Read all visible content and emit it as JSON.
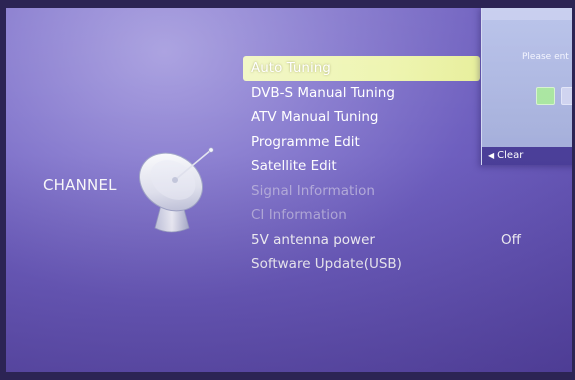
{
  "section": {
    "title": "CHANNEL"
  },
  "menu": {
    "items": [
      {
        "label": "Auto Tuning",
        "state": "selected"
      },
      {
        "label": "DVB-S Manual Tuning",
        "state": "enabled"
      },
      {
        "label": "ATV Manual Tuning",
        "state": "enabled"
      },
      {
        "label": "Programme Edit",
        "state": "enabled"
      },
      {
        "label": "Satellite Edit",
        "state": "enabled"
      },
      {
        "label": "Signal Information",
        "state": "disabled"
      },
      {
        "label": "CI Information",
        "state": "disabled"
      },
      {
        "label": "5V antenna power",
        "state": "enabled",
        "value": "Off"
      },
      {
        "label": "Software Update(USB)",
        "state": "enabled"
      }
    ]
  },
  "popup": {
    "prompt": "Please ent",
    "footer_label": "Clear",
    "footer_icon": "left-arrow-icon"
  },
  "icons": {
    "section_icon": "satellite-dish-icon"
  },
  "colors": {
    "background": "#7a6cc8",
    "selected_highlight": "#eef5b0",
    "disabled_text": "#b8b0de",
    "popup_footer": "#4b3f99"
  }
}
